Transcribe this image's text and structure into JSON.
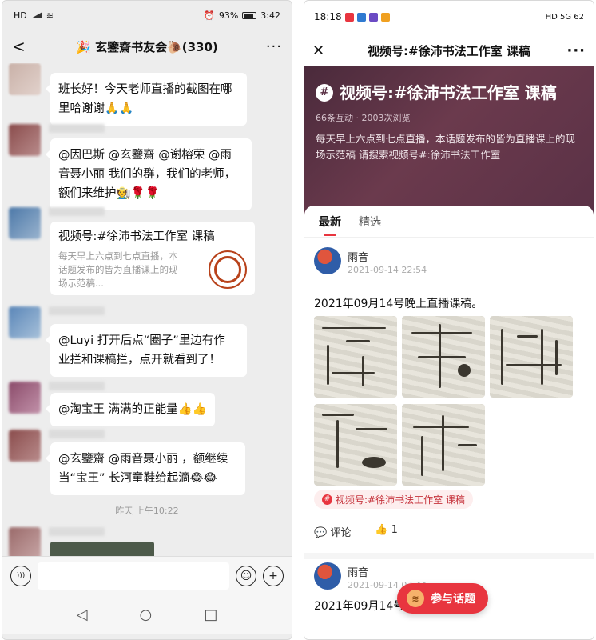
{
  "left": {
    "status": {
      "left": "HD",
      "battery": "93%",
      "time": "3:42"
    },
    "header": {
      "back": "<",
      "title": "🎉 玄鑒齋书友会🐌(330)",
      "more": "···"
    },
    "messages": [
      {
        "text": "班长好！今天老师直播的截图在哪\n里哈谢谢🙏🙏"
      },
      {
        "text": "@因巴斯 @玄鑒齋 @谢榕荣 @雨\n音聂小丽  我们的群，我们的老师，\n额们来维护🧑‍🌾🌹🌹"
      },
      {
        "card_title": "视频号:#徐沛书法工作室 课稿",
        "card_desc": "每天早上六点到七点直播，本话题发布的皆为直播课上的现场示范稿..."
      },
      {
        "text": "@Luyi 打开后点“圈子”里边有作\n业拦和课稿拦，点开就看到了！"
      },
      {
        "text": "@淘宝王  满满的正能量👍👍"
      },
      {
        "text": "@玄鑒齋 @雨音聂小丽 ，额继续\n当“宝王”  长河童鞋给起滴😂😂"
      }
    ],
    "timestamp": "昨天 上午10:22",
    "input": {
      "voice": ")))",
      "emoji": "☺",
      "plus": "+"
    },
    "nav": {
      "back": "◁",
      "home": "○",
      "recent": "□"
    }
  },
  "right": {
    "status": {
      "time": "18:18",
      "right": "HD 5G 62"
    },
    "header": {
      "close": "✕",
      "title": "视频号:#徐沛书法工作室 课稿",
      "more": "···"
    },
    "hero": {
      "title": "视频号:#徐沛书法工作室 课稿",
      "stats": "66条互动 · 2003次浏览",
      "desc": "每天早上六点到七点直播，本话题发布的皆为直播课上的现场示范稿 请搜索视频号#:徐沛书法工作室"
    },
    "tabs": [
      "最新",
      "精选"
    ],
    "post1": {
      "author": "雨音",
      "date": "2021-09-14 22:54",
      "text": "2021年09月14号晚上直播课稿。",
      "tag": "视频号:#徐沛书法工作室 课稿",
      "comment": "评论",
      "likes": "1"
    },
    "post2": {
      "author": "雨音",
      "date": "2021-09-14 07:44",
      "text": "2021年09月14号"
    },
    "fab": "参与话题"
  },
  "colors": {
    "accent": "#e8353f",
    "chat_bg": "#ededed",
    "hero_bg": "#5a3146"
  },
  "icons": [
    "back-icon",
    "more-icon",
    "voice-icon",
    "emoji-icon",
    "plus-icon",
    "close-icon",
    "comment-icon",
    "like-icon",
    "hash-icon"
  ]
}
